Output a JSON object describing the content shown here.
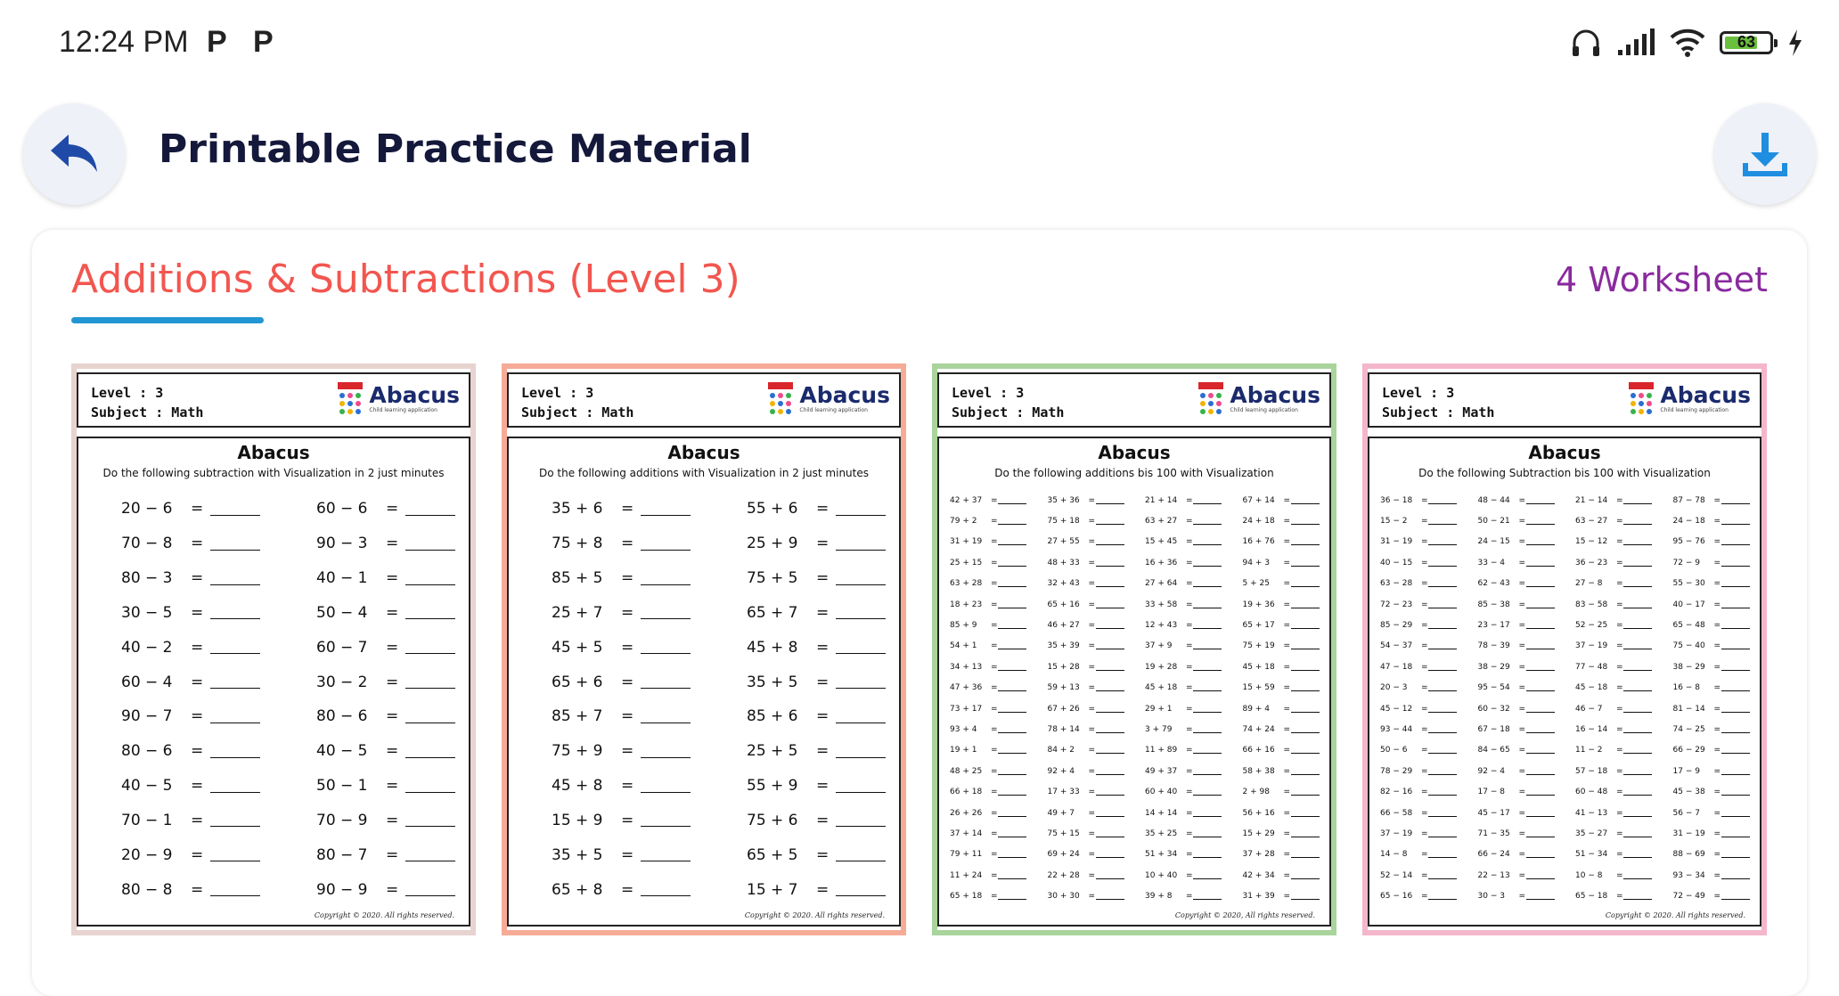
{
  "status_bar": {
    "time": "12:24 PM",
    "notif_1": "P",
    "notif_2": "P",
    "battery_level": "63",
    "icons": [
      "headphones-icon",
      "signal-icon",
      "wifi-icon",
      "battery-icon",
      "charging-icon"
    ]
  },
  "header": {
    "title": "Printable Practice Material"
  },
  "section": {
    "title": "Additions & Subtractions (Level 3)",
    "count": "4 Worksheet",
    "title_color": "#f2564f",
    "count_color": "#8a2a9e",
    "underline_color": "#2196d3"
  },
  "worksheets": [
    {
      "border_color": "#e7d3cf",
      "level": "Level : 3",
      "subject": "Subject : Math",
      "brand": "Abacus",
      "brand_tag": "Child learning application",
      "title": "Abacus",
      "instructions": "Do the following subtraction with Visualization in 2 just minutes",
      "copyright": "Copyright © 2020. All rights reserved.",
      "problems": [
        "20 − 6",
        "60 − 6",
        "70 − 8",
        "90 − 3",
        "80 − 3",
        "40 − 1",
        "30 − 5",
        "50 − 4",
        "40 − 2",
        "60 − 7",
        "60 − 4",
        "30 − 2",
        "90 − 7",
        "80 − 6",
        "80 − 6",
        "40 − 5",
        "40 − 5",
        "50 − 1",
        "70 − 1",
        "70 − 9",
        "20 − 9",
        "80 − 7",
        "80 − 8",
        "90 − 9"
      ]
    },
    {
      "border_color": "#f6ab97",
      "level": "Level : 3",
      "subject": "Subject : Math",
      "brand": "Abacus",
      "brand_tag": "Child learning application",
      "title": "Abacus",
      "instructions": "Do the following additions with Visualization in 2 just minutes",
      "copyright": "Copyright © 2020. All rights reserved.",
      "problems": [
        "35 + 6",
        "55 + 6",
        "75 + 8",
        "25 + 9",
        "85 + 5",
        "75 + 5",
        "25 + 7",
        "65 + 7",
        "45 + 5",
        "45 + 8",
        "65 + 6",
        "35 + 5",
        "85 + 7",
        "85 + 6",
        "75 + 9",
        "25 + 5",
        "45 + 8",
        "55 + 9",
        "15 + 9",
        "75 + 6",
        "35 + 5",
        "65 + 5",
        "65 + 8",
        "15 + 7"
      ]
    },
    {
      "border_color": "#a9d49c",
      "level": "Level : 3",
      "subject": "Subject : Math",
      "brand": "Abacus",
      "brand_tag": "Child learning application",
      "title": "Abacus",
      "instructions": "Do the following additions bis 100 with Visualization",
      "copyright": "Copyright © 2020, All rights reserved.",
      "problems": [
        "42 + 37",
        "35 + 36",
        "21 + 14",
        "67 + 14",
        "79 + 2",
        "75 + 18",
        "63 + 27",
        "24 + 18",
        "31 + 19",
        "27 + 55",
        "15 + 45",
        "16 + 76",
        "25 + 15",
        "48 + 33",
        "16 + 36",
        "94 + 3",
        "63 + 28",
        "32 + 43",
        "27 + 64",
        "5 + 25",
        "18 + 23",
        "65 + 16",
        "33 + 58",
        "19 + 36",
        "85 + 9",
        "46 + 27",
        "12 + 43",
        "65 + 17",
        "54 + 1",
        "35 + 39",
        "37 + 9",
        "75 + 19",
        "34 + 13",
        "15 + 28",
        "19 + 28",
        "45 + 18",
        "47 + 36",
        "59 + 13",
        "45 + 18",
        "15 + 59",
        "73 + 17",
        "67 + 26",
        "29 + 1",
        "89 + 4",
        "93 + 4",
        "78 + 14",
        "3 + 79",
        "74 + 24",
        "19 + 1",
        "84 + 2",
        "11 + 89",
        "66 + 16",
        "48 + 25",
        "92 + 4",
        "49 + 37",
        "58 + 38",
        "66 + 18",
        "17 + 33",
        "60 + 40",
        "2 + 98",
        "26 + 26",
        "49 + 7",
        "14 + 14",
        "56 + 16",
        "37 + 14",
        "75 + 15",
        "35 + 25",
        "15 + 29",
        "79 + 11",
        "69 + 24",
        "51 + 34",
        "37 + 28",
        "11 + 24",
        "22 + 28",
        "10 + 40",
        "42 + 34",
        "65 + 18",
        "30 + 30",
        "39 + 8",
        "31 + 39"
      ]
    },
    {
      "border_color": "#f4b6cb",
      "level": "Level : 3",
      "subject": "Subject : Math",
      "brand": "Abacus",
      "brand_tag": "Child learning application",
      "title": "Abacus",
      "instructions": "Do the following Subtraction bis 100 with Visualization",
      "copyright": "Copyright © 2020. All rights reserved.",
      "problems": [
        "36 − 18",
        "48 − 44",
        "21 − 14",
        "87 − 78",
        "15 − 2",
        "50 − 21",
        "63 − 27",
        "24 − 18",
        "31 − 19",
        "24 − 15",
        "15 − 12",
        "95 − 76",
        "40 − 15",
        "33 − 4",
        "36 − 23",
        "72 − 9",
        "63 − 28",
        "62 − 43",
        "27 − 8",
        "55 − 30",
        "72 − 23",
        "85 − 38",
        "83 − 58",
        "40 − 17",
        "85 − 29",
        "23 − 17",
        "52 − 25",
        "65 − 48",
        "54 − 37",
        "78 − 39",
        "37 − 19",
        "75 − 40",
        "47 − 18",
        "38 − 29",
        "77 − 48",
        "38 − 29",
        "20 − 3",
        "95 − 54",
        "45 − 18",
        "16 − 8",
        "45 − 12",
        "60 − 32",
        "46 − 7",
        "81 − 14",
        "93 − 44",
        "67 − 18",
        "16 − 14",
        "74 − 25",
        "50 − 6",
        "84 − 65",
        "11 − 2",
        "66 − 29",
        "78 − 29",
        "92 − 4",
        "57 − 18",
        "17 − 9",
        "82 − 16",
        "17 − 8",
        "60 − 48",
        "45 − 38",
        "66 − 58",
        "45 − 17",
        "41 − 13",
        "56 − 7",
        "37 − 19",
        "71 − 35",
        "35 − 27",
        "31 − 19",
        "14 − 8",
        "66 − 24",
        "51 − 34",
        "88 − 69",
        "52 − 14",
        "22 − 13",
        "10 − 8",
        "93 − 34",
        "65 − 16",
        "30 − 3",
        "65 − 18",
        "72 − 49"
      ]
    }
  ]
}
